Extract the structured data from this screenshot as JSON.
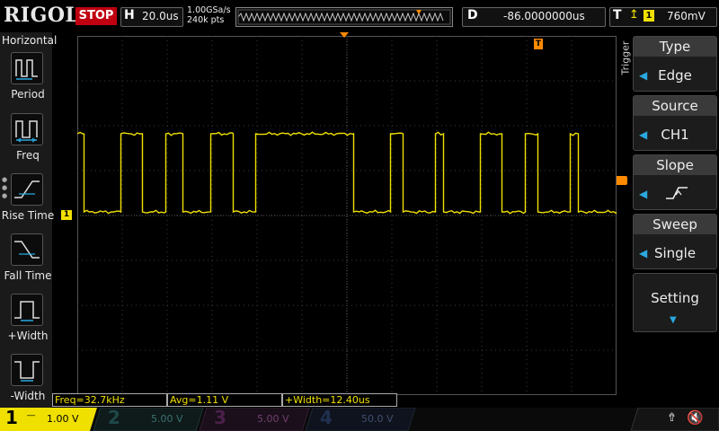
{
  "header": {
    "brand": "RIGOL",
    "run_state": "STOP",
    "horizontal_letter": "H",
    "timebase": "20.0us",
    "sample_rate": "1.00GSa/s",
    "memory_depth": "240k pts",
    "delay_letter": "D",
    "delay": "-86.0000000us",
    "trigger_letter": "T",
    "trigger_source_badge": "1",
    "trigger_level": "760mV"
  },
  "left_menu": {
    "title": "Horizontal",
    "items": [
      {
        "label": "Period",
        "icon": "period-icon"
      },
      {
        "label": "Freq",
        "icon": "frequency-icon"
      },
      {
        "label": "Rise Time",
        "icon": "rise-time-icon"
      },
      {
        "label": "Fall Time",
        "icon": "fall-time-icon"
      },
      {
        "label": "+Width",
        "icon": "positive-width-icon"
      },
      {
        "label": "-Width",
        "icon": "negative-width-icon"
      }
    ]
  },
  "trigger_menu": {
    "tab_label": "Trigger",
    "type": {
      "title": "Type",
      "value": "Edge"
    },
    "source": {
      "title": "Source",
      "value": "CH1"
    },
    "slope": {
      "title": "Slope",
      "icon": "rising-edge-icon"
    },
    "sweep": {
      "title": "Sweep",
      "value": "Single"
    },
    "setting": {
      "title": "Setting"
    }
  },
  "measurements": [
    {
      "text": "Freq=32.7kHz"
    },
    {
      "text": "Avg=1.11 V"
    },
    {
      "text": "+Width=12.40us"
    }
  ],
  "channels": [
    {
      "num": "1",
      "scale": "1.00 V",
      "color": "#f0e000",
      "active": true
    },
    {
      "num": "2",
      "scale": "5.00 V",
      "color": "#00c8c8",
      "active": false
    },
    {
      "num": "3",
      "scale": "5.00 V",
      "color": "#e040e0",
      "active": false
    },
    {
      "num": "4",
      "scale": "50.0 V",
      "color": "#3080ff",
      "active": false
    }
  ],
  "markers": {
    "ch1_marker": "1",
    "trigger_position_marker": "T"
  },
  "waveform": {
    "channel": "CH1",
    "high_level": 2.3,
    "low_level": 0.0,
    "edges_divisions": [
      0.15,
      0.97,
      1.45,
      1.97,
      2.35,
      2.97,
      3.47,
      3.97,
      6.15,
      6.97,
      7.25,
      7.97,
      8.15,
      8.97,
      9.45,
      9.97,
      10.25,
      10.97,
      11.15
    ]
  },
  "colors": {
    "ch1": "#f0e000",
    "stop": "#c00010",
    "accent": "#2aa8e0",
    "trigger_marker": "#ff8a00"
  }
}
